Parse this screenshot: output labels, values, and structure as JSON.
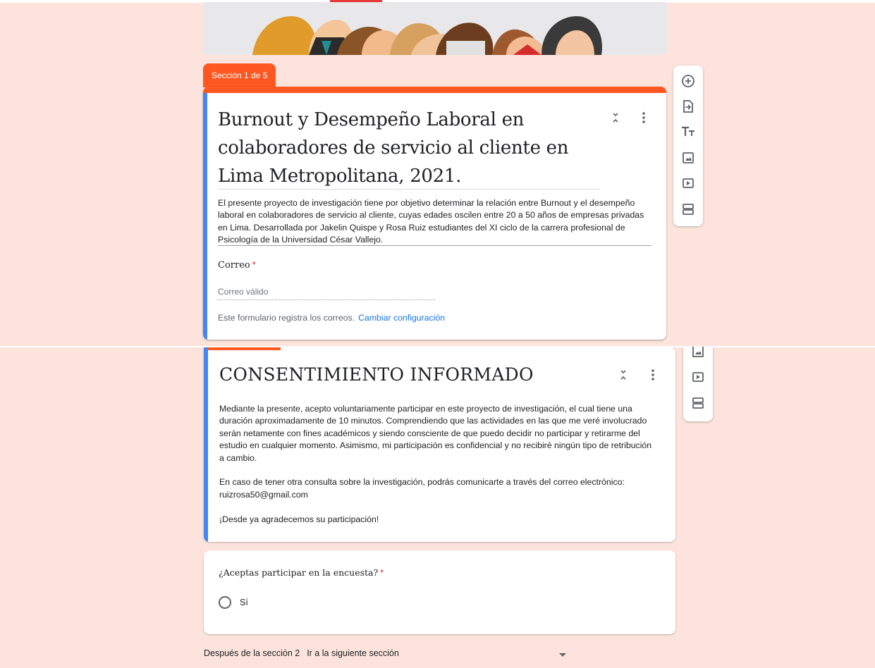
{
  "section1": {
    "tab_label": "Sección 1 de 5",
    "title": "Burnout y Desempeño Laboral en colaboradores de servicio al cliente en Lima Metropolitana, 2021.",
    "description": "El presente proyecto de investigación tiene por objetivo determinar la relación entre Burnout y el desempeño laboral en colaboradores de servicio al cliente, cuyas edades oscilen entre 20 a 50 años de empresas privadas en Lima. Desarrollada por Jakelin Quispe y Rosa Ruiz estudiantes del XI ciclo de la carrera profesional de Psicología de la Universidad César Vallejo.",
    "email_label": "Correo",
    "required_mark": "*",
    "email_placeholder": "Correo válido",
    "collect_note": "Este formulario registra los correos.",
    "collect_link": "Cambiar configuración"
  },
  "section2": {
    "title": "CONSENTIMIENTO INFORMADO",
    "paragraph1": "Mediante la presente, acepto voluntariamente participar en este proyecto de investigación, el cual tiene una duración aproximadamente de 10 minutos. Comprendiendo que las actividades en las que me veré involucrado serán netamente con fines académicos y siendo consciente de que puedo decidir no participar y retirarme del estudio en cualquier momento. Asimismo, mi participación es confidencial y no recibiré ningún tipo de retribución a cambio.",
    "paragraph2": "En caso de tener otra consulta sobre la investigación, podrás comunicarte a través del correo electrónico: ruizrosa50@gmail.com",
    "paragraph3": "¡Desde ya agradecemos su participación!"
  },
  "question": {
    "text": "¿Aceptas participar en la encuesta?",
    "required_mark": "*",
    "options": [
      "Sí"
    ]
  },
  "after_section": {
    "label": "Después de la sección 2",
    "selected": "Ir a la siguiente sección"
  },
  "toolbar_icons": [
    "add-question-icon",
    "import-questions-icon",
    "add-title-icon",
    "add-image-icon",
    "add-video-icon",
    "add-section-icon"
  ],
  "colors": {
    "accent": "#ff5722",
    "focus": "#4285f4",
    "background": "#fce4dc",
    "link": "#1a73e8"
  }
}
